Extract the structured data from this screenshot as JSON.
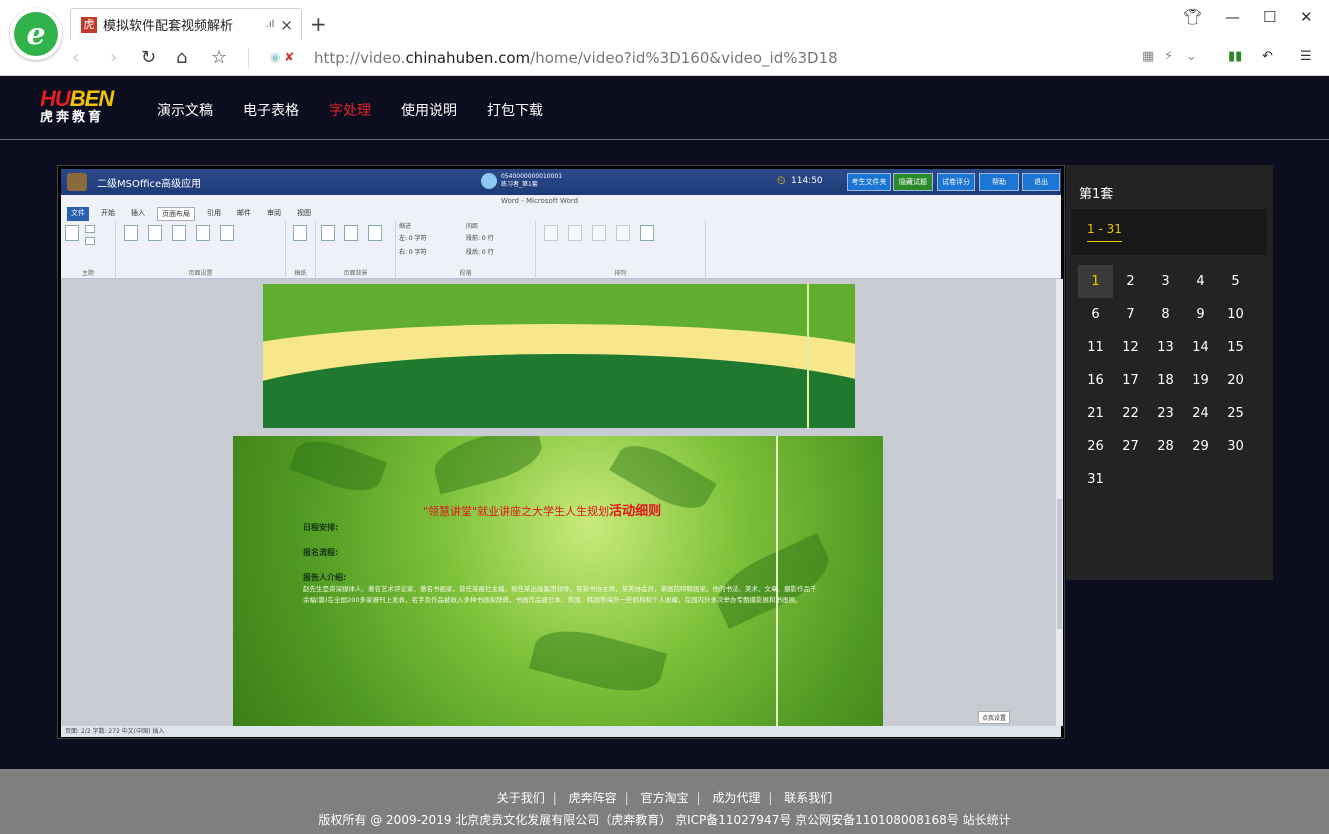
{
  "browser": {
    "tab_title": "模拟软件配套视频解析",
    "tab_favicon": "虎",
    "tab_audio_icon": ".ıl",
    "tab_close": "×",
    "new_tab": "+",
    "url_prefix": "http://video.",
    "url_domain": "chinahuben.com",
    "url_suffix": "/home/video?id%3D160&video_id%3D18",
    "logo_letter": "e"
  },
  "site": {
    "brand_top_a": "HU",
    "brand_top_b": "BEN",
    "brand_bottom": "虎奔教育",
    "nav": [
      {
        "label": "演示文稿",
        "active": false
      },
      {
        "label": "电子表格",
        "active": false
      },
      {
        "label": "字处理",
        "active": true
      },
      {
        "label": "使用说明",
        "active": false
      },
      {
        "label": "打包下载",
        "active": false
      }
    ]
  },
  "video": {
    "app_title": "二级MSOffice高级应用",
    "user_id": "0540000000010001",
    "user_set": "练习者_第1套",
    "timer": "114:50",
    "buttons": [
      "考生文件夹",
      "隐藏试题",
      "试卷评分",
      "帮助",
      "退出"
    ],
    "word_title": "Word - Microsoft Word",
    "ribbon_tabs": [
      "文件",
      "开始",
      "插入",
      "页面布局",
      "引用",
      "邮件",
      "审阅",
      "视图"
    ],
    "ribbon_groups": [
      "主题",
      "页面设置",
      "稿纸",
      "页面背景",
      "段落",
      "排列"
    ],
    "ribbon_labels": {
      "indent": "缩进",
      "spacing": "间距",
      "left": "左: 0 字符",
      "right": "右: 0 字符",
      "before": "段前: 0 行",
      "after": "段后: 0 行"
    },
    "doc_heading": "\"领慧讲堂\"就业讲座之大学生人生规划",
    "doc_heading_b": "活动细则",
    "doc_line1": "日程安排:",
    "doc_line2": "报名流程:",
    "doc_line3": "报告人介绍:",
    "doc_para": "赵先生是资深媒体人、著名艺术评论家、著名书画家，曾任某报社主编，现任某出版集团领导，某某书协主席，某美协会员，某画院特聘画家。他的书法、美术、文章、摄影作品千余幅(篇)在全国200多家报刊上发表，名字及作品被收入多种书画家辞典，书画作品被日本、美国、韩国等海外一些机构和个人收藏，在国内外多次举办专题摄影展和书画展。",
    "tooltip": "点我设置",
    "status": "页面: 2/2   字数: 272   中文(中国)   插入"
  },
  "panel": {
    "title": "第1套",
    "range": "1 - 31",
    "numbers": [
      "1",
      "2",
      "3",
      "4",
      "5",
      "6",
      "7",
      "8",
      "9",
      "10",
      "11",
      "12",
      "13",
      "14",
      "15",
      "16",
      "17",
      "18",
      "19",
      "20",
      "21",
      "22",
      "23",
      "24",
      "25",
      "26",
      "27",
      "28",
      "29",
      "30",
      "31"
    ],
    "active_index": 0
  },
  "footer": {
    "links": [
      "关于我们",
      "虎奔阵容",
      "官方淘宝",
      "成为代理",
      "联系我们"
    ],
    "copyright": "版权所有 @ 2009-2019 北京虎贲文化发展有限公司（虎奔教育） 京ICP备11027947号 京公网安备110108008168号 站长统计"
  },
  "colors": {
    "accent_red": "#e6212a",
    "accent_yellow": "#f2c500",
    "page_bg": "#0c0d1e"
  }
}
